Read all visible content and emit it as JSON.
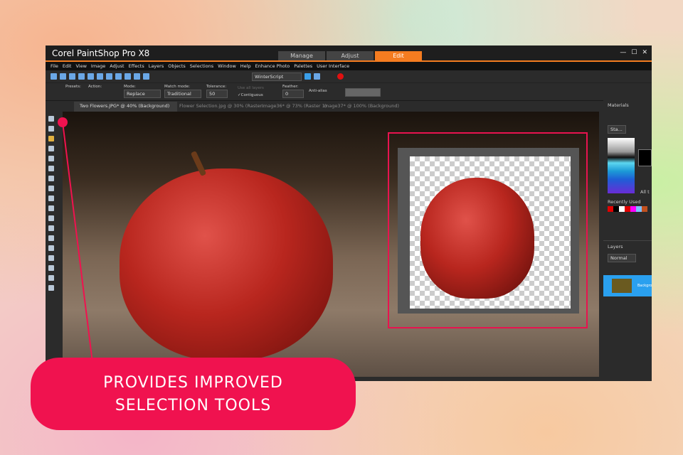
{
  "app": {
    "title": "Corel PaintShop Pro X8",
    "workspace_tabs": [
      "Manage",
      "Adjust",
      "Edit"
    ],
    "active_tab": "Edit"
  },
  "menu": [
    "File",
    "Edit",
    "View",
    "Image",
    "Adjust",
    "Effects",
    "Layers",
    "Objects",
    "Selections",
    "Window",
    "Help",
    "Enhance Photo",
    "Palettes",
    "User Interface"
  ],
  "toolbar": {
    "script": "WinterScript"
  },
  "options": {
    "presets_label": "Presets:",
    "action_label": "Action:",
    "mode_label": "Mode:",
    "mode": "Replace",
    "match_label": "Match mode:",
    "match": "Traditional",
    "tolerance_label": "Tolerance:",
    "tolerance": "50",
    "use_all_layers": "Use all layers",
    "contiguous": "Contiguous",
    "feather_label": "Feather:",
    "feather": "0",
    "antialias": "Anti-alias"
  },
  "doc_tabs": [
    "Two Flowers.JPG* @  40% (Background)",
    "Flower Selection.jpg @  30% (Raster...",
    "Image36* @  73% (Raster 1)",
    "Image37* @ 100% (Background)"
  ],
  "materials": {
    "title": "Materials",
    "style": "Sta...",
    "recent": "Recently Used",
    "all": "All t",
    "recent_colors": [
      "#e00000",
      "#000000",
      "#ffffff",
      "#e00000",
      "#ff00ff",
      "#7fbfff",
      "#c0501f"
    ]
  },
  "layers": {
    "title": "Layers",
    "blend": "Normal",
    "layer_name": "Backgro"
  },
  "callout": {
    "line1": "PROVIDES IMPROVED",
    "line2": "SELECTION TOOLS",
    "color": "#f0124f"
  }
}
